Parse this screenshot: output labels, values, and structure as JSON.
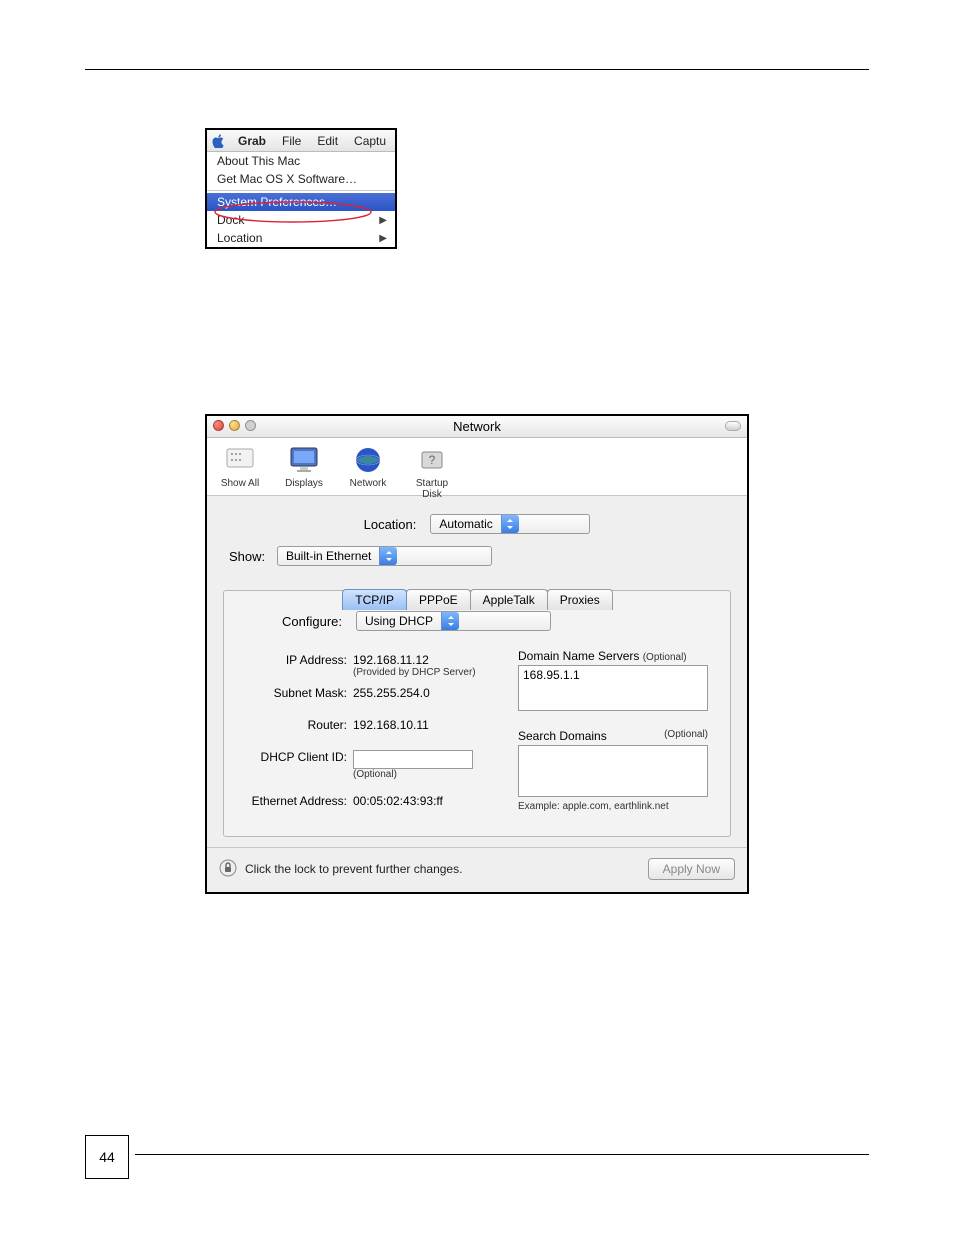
{
  "page_number": "44",
  "menubar": {
    "items": [
      "Grab",
      "File",
      "Edit",
      "Captu"
    ]
  },
  "apple_menu": {
    "about": "About This Mac",
    "get_software": "Get Mac OS X Software…",
    "sys_prefs": "System Preferences…",
    "dock": "Dock",
    "location": "Location"
  },
  "network": {
    "title": "Network",
    "toolbar": {
      "show_all": "Show All",
      "displays": "Displays",
      "network": "Network",
      "startup_disk": "Startup Disk"
    },
    "location_label": "Location:",
    "location_value": "Automatic",
    "show_label": "Show:",
    "show_value": "Built-in Ethernet",
    "tabs": {
      "tcpip": "TCP/IP",
      "pppoe": "PPPoE",
      "appletalk": "AppleTalk",
      "proxies": "Proxies"
    },
    "configure_label": "Configure:",
    "configure_value": "Using DHCP",
    "ip_label": "IP Address:",
    "ip_value": "192.168.11.12",
    "ip_note": "(Provided by DHCP Server)",
    "subnet_label": "Subnet Mask:",
    "subnet_value": "255.255.254.0",
    "router_label": "Router:",
    "router_value": "192.168.10.11",
    "dhcp_client_label": "DHCP Client ID:",
    "dhcp_client_note": "(Optional)",
    "eth_addr_label": "Ethernet Address:",
    "eth_addr_value": "00:05:02:43:93:ff",
    "dns_label": "Domain Name Servers",
    "dns_optional": "(Optional)",
    "dns_value": "168.95.1.1",
    "search_label": "Search Domains",
    "search_optional": "(Optional)",
    "search_example": "Example: apple.com, earthlink.net",
    "lock_text": "Click the lock to prevent further changes.",
    "apply_now": "Apply Now"
  }
}
